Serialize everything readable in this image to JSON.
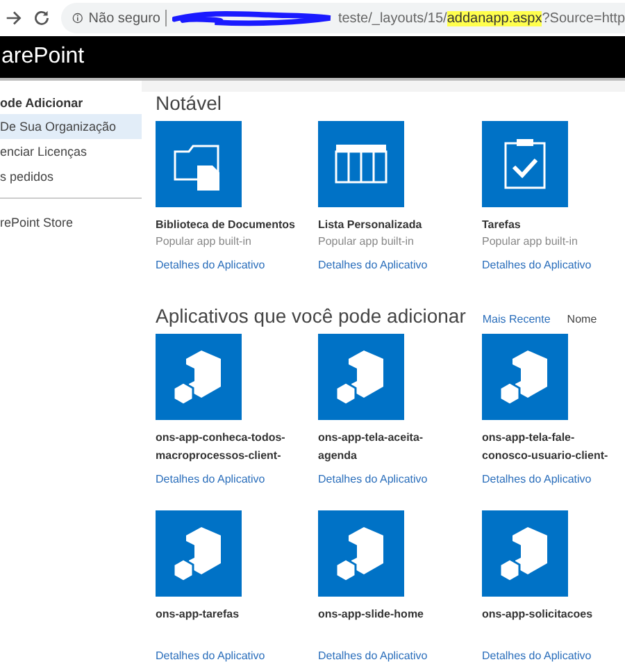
{
  "browser": {
    "security": "Não seguro",
    "url": [
      {
        "text": "teste/_layouts/15/",
        "highlighted": false
      },
      {
        "text": "addanapp.aspx",
        "highlighted": true
      },
      {
        "text": "?Source=http",
        "highlighted": false
      }
    ]
  },
  "header": {
    "title": "arePoint"
  },
  "sidebar": {
    "items": [
      {
        "label": "ode Adicionar",
        "selected": false,
        "kind": "heading"
      },
      {
        "label": "De Sua Organização",
        "selected": true,
        "kind": "item"
      },
      {
        "label": "enciar Licenças",
        "selected": false,
        "kind": "item"
      },
      {
        "label": "s pedidos",
        "selected": false,
        "kind": "item"
      },
      {
        "label": "rePoint Store",
        "selected": false,
        "kind": "store"
      }
    ]
  },
  "featured": {
    "title": "Notável",
    "apps": [
      {
        "name": [
          "Biblioteca de Documentos"
        ],
        "subtitle": "Popular app built-in",
        "link": "Detalhes do Aplicativo",
        "kind": "library"
      },
      {
        "name": [
          "Lista Personalizada"
        ],
        "subtitle": "Popular app built-in",
        "link": "Detalhes do Aplicativo",
        "kind": "list"
      },
      {
        "name": [
          "Tarefas"
        ],
        "subtitle": "Popular app built-in",
        "link": "Detalhes do Aplicativo",
        "kind": "tasks"
      }
    ]
  },
  "available": {
    "title": "Aplicativos que você pode adicionar",
    "sort": [
      {
        "label": "Mais Recente",
        "selected": false
      },
      {
        "label": "Nome",
        "selected": true
      }
    ],
    "apps": [
      {
        "name": [
          "ons-app-conheca-todos-",
          "macroprocessos-client-"
        ],
        "link": "Detalhes do Aplicativo",
        "kind": "addin"
      },
      {
        "name": [
          "ons-app-tela-aceita-",
          "agenda"
        ],
        "link": "Detalhes do Aplicativo",
        "kind": "addin"
      },
      {
        "name": [
          "ons-app-tela-fale-",
          "conosco-usuario-client-"
        ],
        "link": "Detalhes do Aplicativo",
        "kind": "addin"
      },
      {
        "name": [
          "ons-app-tarefas"
        ],
        "link": "Detalhes do Aplicativo",
        "kind": "addin"
      },
      {
        "name": [
          "ons-app-slide-home"
        ],
        "link": "Detalhes do Aplicativo",
        "kind": "addin"
      },
      {
        "name": [
          "ons-app-solicitacoes"
        ],
        "link": "Detalhes do Aplicativo",
        "kind": "addin"
      }
    ]
  }
}
